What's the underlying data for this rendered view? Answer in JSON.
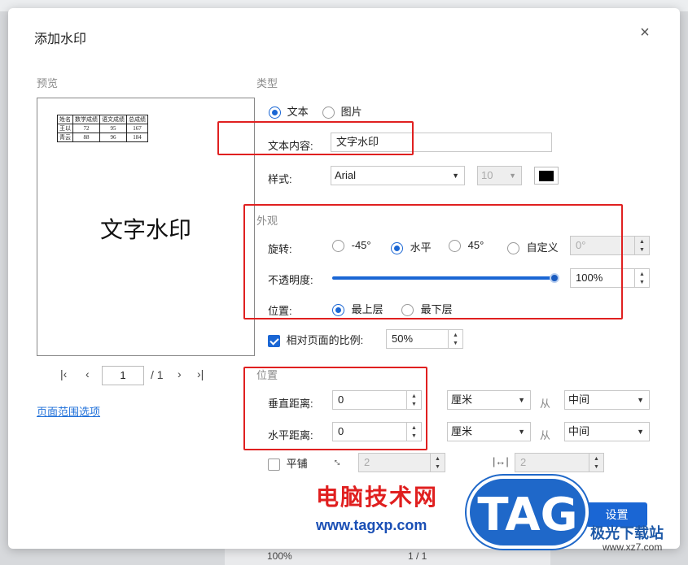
{
  "dialog": {
    "title": "添加水印",
    "close_icon": "close-icon"
  },
  "preview": {
    "label": "预览",
    "table": [
      [
        "姓名",
        "数学成绩",
        "语文成绩",
        "总成绩"
      ],
      [
        "王以",
        "72",
        "95",
        "167"
      ],
      [
        "青云",
        "88",
        "96",
        "184"
      ]
    ],
    "watermark_text": "文字水印",
    "pager": {
      "current": "1",
      "total": "/ 1"
    },
    "page_range_link": "页面范围选项"
  },
  "type": {
    "label": "类型",
    "options": [
      "文本",
      "图片"
    ],
    "selected": "文本"
  },
  "text_content": {
    "label": "文本内容:",
    "value": "文字水印"
  },
  "style": {
    "label": "样式:",
    "font": "Arial",
    "size": "10",
    "color": "#000000"
  },
  "appearance": {
    "label": "外观",
    "rotation": {
      "label": "旋转:",
      "options": [
        "-45°",
        "水平",
        "45°",
        "自定义"
      ],
      "selected": "水平",
      "custom_value": "0°"
    },
    "opacity": {
      "label": "不透明度:",
      "value": "100%",
      "level": 1.0
    },
    "layer": {
      "label": "位置:",
      "options": [
        "最上层",
        "最下层"
      ],
      "selected": "最上层"
    }
  },
  "scale": {
    "label": "相对页面的比例:",
    "checked": true,
    "value": "50%"
  },
  "position": {
    "label": "位置",
    "vertical": {
      "label": "垂直距离:",
      "value": "0",
      "unit": "厘米",
      "from_label": "从",
      "anchor": "中间"
    },
    "horizontal": {
      "label": "水平距离:",
      "value": "0",
      "unit": "厘米",
      "from_label": "从",
      "anchor": "中间"
    }
  },
  "tile": {
    "label": "平铺",
    "checked": false,
    "vertical_spacing": "2",
    "horizontal_spacing": "2"
  },
  "buttons": {
    "settings": "设置"
  },
  "overlay": {
    "brand": "电脑技术网",
    "url": "www.tagxp.com",
    "tag": "TAG",
    "xz_brand": "极光下载站",
    "xz_url": "www.xz7.com"
  },
  "background_toolbar": {
    "zoom": "100%",
    "page": "1 / 1"
  }
}
